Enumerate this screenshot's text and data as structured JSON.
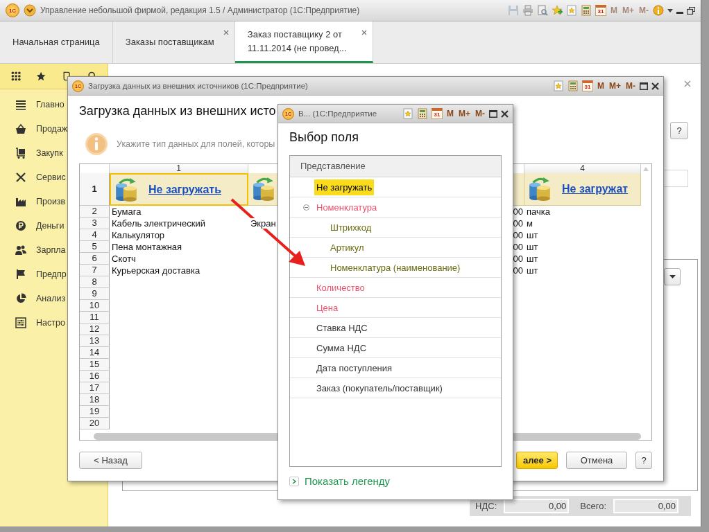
{
  "title_bar": {
    "logo": "1С",
    "title": "Управление небольшой фирмой, редакция 1.5 / Администратор  (1С:Предприятие)",
    "tools": [
      {
        "kind": "save"
      },
      {
        "kind": "print"
      },
      {
        "kind": "preview"
      },
      {
        "kind": "add-favorite"
      },
      {
        "kind": "favorite"
      },
      {
        "kind": "calculator"
      },
      {
        "kind": "calendar",
        "label": "31"
      },
      {
        "kind": "memory",
        "label": "M",
        "disabled": true
      },
      {
        "kind": "memory",
        "label": "M+",
        "disabled": true
      },
      {
        "kind": "memory",
        "label": "M-",
        "disabled": true
      },
      {
        "kind": "info"
      },
      {
        "kind": "caret"
      },
      {
        "kind": "minimize"
      },
      {
        "kind": "restore"
      }
    ]
  },
  "tabs": [
    {
      "label": "Начальная страница",
      "selected": false,
      "closable": false
    },
    {
      "label": "Заказы поставщикам",
      "selected": false,
      "closable": true
    },
    {
      "label": "Заказ поставщику 2 от\n11.11.2014  (не провед...",
      "selected": true,
      "closable": true
    }
  ],
  "sidebar": {
    "items": [
      {
        "label": "Главно"
      },
      {
        "label": "Продаж"
      },
      {
        "label": "Закупк"
      },
      {
        "label": "Сервис"
      },
      {
        "label": "Произв"
      },
      {
        "label": "Деньги"
      },
      {
        "label": "Зарпла"
      },
      {
        "label": "Предпр"
      },
      {
        "label": "Анализ"
      },
      {
        "label": "Настро"
      }
    ]
  },
  "order_form": {
    "help_button": "?",
    "totals": [
      {
        "label": "НДС:",
        "value": "0,00"
      },
      {
        "label": "Всего:",
        "value": "0,00"
      }
    ]
  },
  "import_dialog": {
    "logo": "1С",
    "title": "Загрузка данных из внешних источников  (1С:Предприятие)",
    "tools": [
      {
        "kind": "favorite"
      },
      {
        "kind": "calculator"
      },
      {
        "kind": "calendar",
        "label": "31"
      },
      {
        "kind": "memory",
        "label": "M",
        "disabled": false
      },
      {
        "kind": "memory",
        "label": "M+",
        "disabled": false
      },
      {
        "kind": "memory",
        "label": "M-",
        "disabled": false
      },
      {
        "kind": "maximize"
      },
      {
        "kind": "close"
      }
    ],
    "heading": "Загрузка данных из внешних исто",
    "hint": "Укажите тип данных для полей, которы",
    "table": {
      "columns": [
        {
          "kind": "link",
          "number": "1",
          "field": "Не загружать",
          "selected": true
        },
        {
          "kind": "icon",
          "selected": false
        },
        {
          "kind": "covered",
          "selected": false
        },
        {
          "kind": "link",
          "number": "4",
          "field": "Не загружат",
          "selected": false
        }
      ],
      "first_row_number": "1",
      "rows": [
        {
          "number": "2",
          "column_1": "Бумага",
          "column_3": "00",
          "column_4": "пачка"
        },
        {
          "number": "3",
          "column_1": "Кабель электрический",
          "column_2": "Экран",
          "column_3": "00",
          "column_4": "м"
        },
        {
          "number": "4",
          "column_1": "Калькулятор",
          "column_3": "00",
          "column_4": "шт"
        },
        {
          "number": "5",
          "column_1": "Пена монтажная",
          "column_3": "00",
          "column_4": "шт"
        },
        {
          "number": "6",
          "column_1": "Скотч",
          "column_3": "00",
          "column_4": "шт"
        },
        {
          "number": "7",
          "column_1": "Курьерская доставка",
          "column_3": "00",
          "column_4": "шт"
        },
        {
          "number": "8"
        },
        {
          "number": "9"
        },
        {
          "number": "10"
        },
        {
          "number": "11"
        },
        {
          "number": "12"
        },
        {
          "number": "13"
        },
        {
          "number": "14"
        },
        {
          "number": "15"
        },
        {
          "number": "16"
        },
        {
          "number": "17"
        },
        {
          "number": "18"
        },
        {
          "number": "19"
        },
        {
          "number": "20"
        }
      ]
    },
    "buttons": [
      {
        "kind": "back",
        "label": "< Назад"
      },
      {
        "kind": "primary",
        "label": "алее >"
      },
      {
        "kind": "plain",
        "label": "Отмена"
      },
      {
        "kind": "help",
        "label": "?"
      }
    ]
  },
  "field_dialog": {
    "logo": "1С",
    "title": "В...  (1С:Предприятие",
    "tools": [
      {
        "kind": "favorite"
      },
      {
        "kind": "calculator"
      },
      {
        "kind": "calendar",
        "label": "31"
      },
      {
        "kind": "memory",
        "label": "M",
        "disabled": false
      },
      {
        "kind": "memory",
        "label": "M+",
        "disabled": false
      },
      {
        "kind": "memory",
        "label": "M-",
        "disabled": false
      },
      {
        "kind": "maximize"
      },
      {
        "kind": "close"
      }
    ],
    "heading": "Выбор поля",
    "list_header": "Представление",
    "items": [
      {
        "label": "Не загружать",
        "selected": true,
        "color": "#000000"
      },
      {
        "label": "Номенклатура",
        "selected": false,
        "color": "#f0506e",
        "expanded": true,
        "children": [
          {
            "label": "Штрихкод",
            "selected": false,
            "color": "#6b6b10"
          },
          {
            "label": "Артикул",
            "selected": false,
            "color": "#6b6b10"
          },
          {
            "label": "Номенклатура (наименование)",
            "selected": false,
            "color": "#6b6b10"
          }
        ]
      },
      {
        "label": "Количество",
        "selected": false,
        "color": "#f0506e"
      },
      {
        "label": "Цена",
        "selected": false,
        "color": "#f0506e"
      },
      {
        "label": "Ставка НДС",
        "selected": false,
        "color": "#333333"
      },
      {
        "label": "Сумма НДС",
        "selected": false,
        "color": "#333333"
      },
      {
        "label": "Дата поступления",
        "selected": false,
        "color": "#333333"
      },
      {
        "label": "Заказ (покупатель/поставщик)",
        "selected": false,
        "color": "#333333"
      }
    ],
    "legend_link": "Показать легенду"
  }
}
